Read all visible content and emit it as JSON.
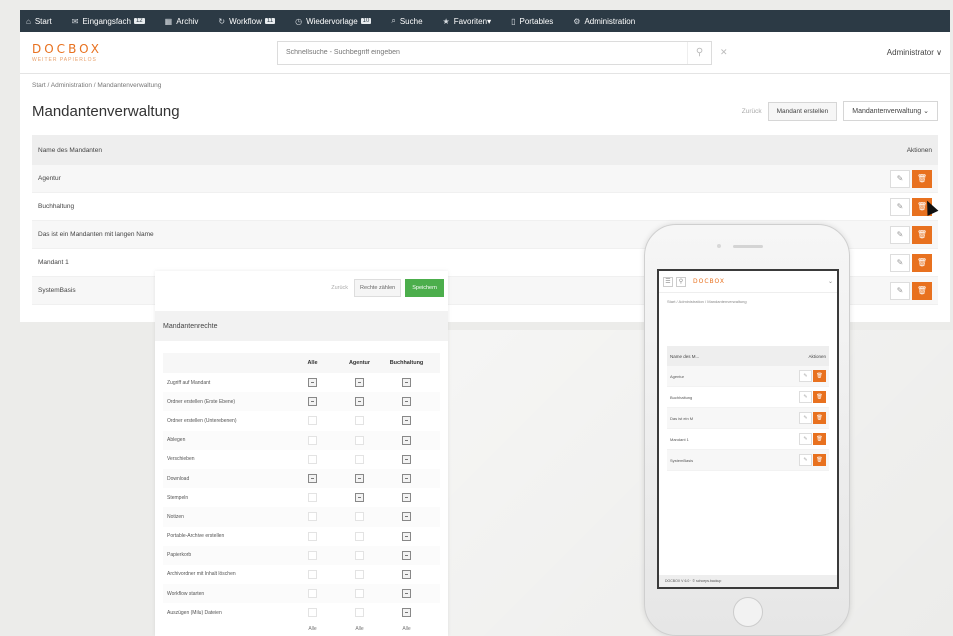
{
  "topnav": {
    "items": [
      {
        "label": "Start",
        "icon": "home-icon"
      },
      {
        "label": "Eingangsfach",
        "icon": "inbox-icon",
        "count": "12"
      },
      {
        "label": "Archiv",
        "icon": "archive-icon"
      },
      {
        "label": "Workflow",
        "icon": "workflow-icon",
        "count": "11"
      },
      {
        "label": "Wiedervorlage",
        "icon": "calendar-icon",
        "count": "10"
      },
      {
        "label": "Suche",
        "icon": "search-icon"
      },
      {
        "label": "Favoriten",
        "icon": "star-icon"
      },
      {
        "label": "Portables",
        "icon": "portable-icon"
      },
      {
        "label": "Administration",
        "icon": "gear-icon"
      }
    ]
  },
  "header": {
    "logo": "DOCBOX",
    "logo_tagline": "WEITER PAPIERLOS",
    "search_placeholder": "Schnellsuche - Suchbegriff eingeben",
    "user": "Administrator ∨"
  },
  "breadcrumb": "Start  /  Administration  /  Mandantenverwaltung",
  "page": {
    "title": "Mandantenverwaltung",
    "back_label": "Zurück",
    "create_label": "Mandant erstellen",
    "select_value": "Mandantenverwaltung"
  },
  "table": {
    "col_name": "Name des Mandanten",
    "col_actions": "Aktionen",
    "rows": [
      {
        "name": "Agentur"
      },
      {
        "name": "Buchhaltung"
      },
      {
        "name": "Das ist ein Mandanten mit langen Name"
      },
      {
        "name": "Mandant 1"
      },
      {
        "name": "SystemBasis"
      }
    ]
  },
  "rights": {
    "back_label": "Zurück",
    "reset_label": "Rechte zählen",
    "save_label": "Speichern",
    "title": "Mandantenrechte",
    "columns": [
      "Alle",
      "Agentur",
      "Buchhaltung"
    ],
    "rows": [
      {
        "label": "Zugriff auf Mandant",
        "checks": [
          "on",
          "on",
          "on"
        ]
      },
      {
        "label": "Ordner erstellen (Erste Ebene)",
        "checks": [
          "on",
          "on",
          "on"
        ]
      },
      {
        "label": "Ordner erstellen (Unterebenen)",
        "checks": [
          "off",
          "off",
          "on"
        ]
      },
      {
        "label": "Ablegen",
        "checks": [
          "off",
          "off",
          "on"
        ]
      },
      {
        "label": "Verschieben",
        "checks": [
          "off",
          "off",
          "on"
        ]
      },
      {
        "label": "Download",
        "checks": [
          "on",
          "on",
          "on"
        ]
      },
      {
        "label": "Stempeln",
        "checks": [
          "off",
          "on",
          "on"
        ]
      },
      {
        "label": "Notizen",
        "checks": [
          "off",
          "off",
          "on"
        ]
      },
      {
        "label": "Portable-Archive erstellen",
        "checks": [
          "off",
          "off",
          "on"
        ]
      },
      {
        "label": "Papierkorb",
        "checks": [
          "off",
          "off",
          "on"
        ]
      },
      {
        "label": "Archivordner mit Inhalt löschen",
        "checks": [
          "off",
          "off",
          "on"
        ]
      },
      {
        "label": "Workflow starten",
        "checks": [
          "off",
          "off",
          "on"
        ]
      },
      {
        "label": "Auszügen (Milu) Dateien",
        "checks": [
          "off",
          "off",
          "on"
        ]
      }
    ],
    "footer": [
      "Alle",
      "Alle",
      "Alle"
    ]
  },
  "phone": {
    "logo": "DOCBOX",
    "breadcrumb": "Start  /  Administration  /  Mandantenverwaltung",
    "col_name": "Name des M...",
    "col_actions": "Aktionen",
    "rows": [
      {
        "name": "Agentur"
      },
      {
        "name": "Buchhaltung"
      },
      {
        "name": "Das ist ein M"
      },
      {
        "name": "Mandant 1"
      },
      {
        "name": "SystemBasis"
      }
    ],
    "footer": "DOCBOX V 6.0 · © schoeps.backup"
  }
}
